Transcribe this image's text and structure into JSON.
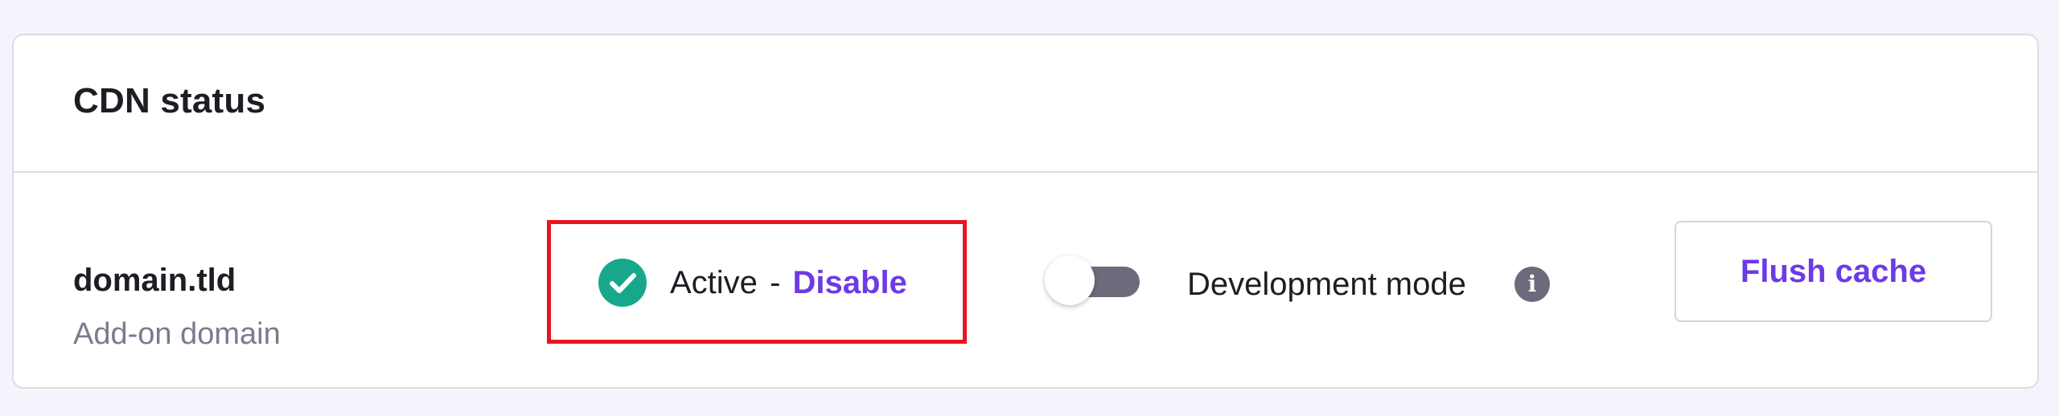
{
  "card": {
    "title": "CDN status"
  },
  "domain": {
    "name": "domain.tld",
    "type": "Add-on domain"
  },
  "status": {
    "state": "Active",
    "separator": "-",
    "action_label": "Disable",
    "icon": "check-circle-icon",
    "color": "#17a88b"
  },
  "dev_mode": {
    "label": "Development mode",
    "enabled": false,
    "info_icon": "info-icon"
  },
  "actions": {
    "flush_cache_label": "Flush cache"
  },
  "colors": {
    "accent": "#6d3ae6",
    "highlight_border": "#e8141e",
    "toggle_off": "#6b6b7b",
    "page_background": "#f4f4fd"
  }
}
